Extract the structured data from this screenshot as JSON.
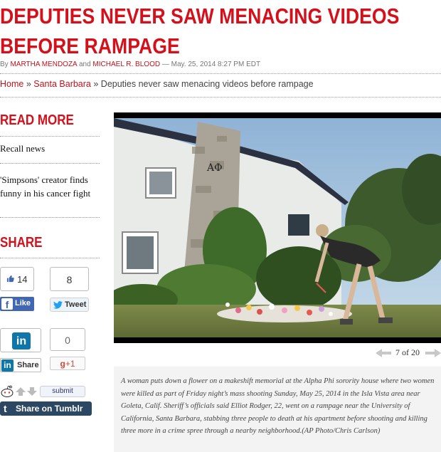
{
  "article": {
    "headline": "DEPUTIES NEVER SAW MENACING VIDEOS BEFORE RAMPAGE",
    "byline_prefix": "By",
    "author1": "MARTHA MENDOZA",
    "byline_and": "and",
    "author2": "MICHAEL R. BLOOD",
    "date": "— May. 25, 2014 8:27 PM EDT"
  },
  "breadcrumb": {
    "home": "Home",
    "sep1": "»",
    "section": "Santa Barbara",
    "sep2": "»",
    "current": "Deputies never saw menacing videos before rampage"
  },
  "sidebar": {
    "read_more_title": "READ MORE",
    "links": [
      "Recall news",
      "'Simpsons' creator finds funny in his cancer fight"
    ],
    "share_title": "SHARE"
  },
  "share": {
    "fb_count": "14",
    "fb_label": "Like",
    "tweet_count": "8",
    "tweet_label": "Tweet",
    "linkedin_count": "0",
    "linkedin_label": "Share",
    "gplus_label": "+1",
    "reddit_label": "submit",
    "tumblr_label": "Share on Tumblr"
  },
  "gallery": {
    "counter": "7 of 20",
    "caption": "A woman puts down a flower on a makeshift memorial at the Alpha Phi sorority house where two women were killed as part of Friday night’s mass shooting Sunday, May 25, 2014 in the Isla Vista area near Goleta, Calif. Sheriff’s officials said Elliot Rodger, 22, went on a rampage near the University of California, Santa Barbara, stabbing three people to death at his apartment before shooting and killing three more in a crime spree through a nearby neighborhood.(AP Photo/Chris Carlson)",
    "photo_sign": "ΑΦ"
  },
  "colors": {
    "brand_red": "#d4111b",
    "facebook_blue": "#4267b2",
    "tumblr_navy": "#2c4762"
  }
}
